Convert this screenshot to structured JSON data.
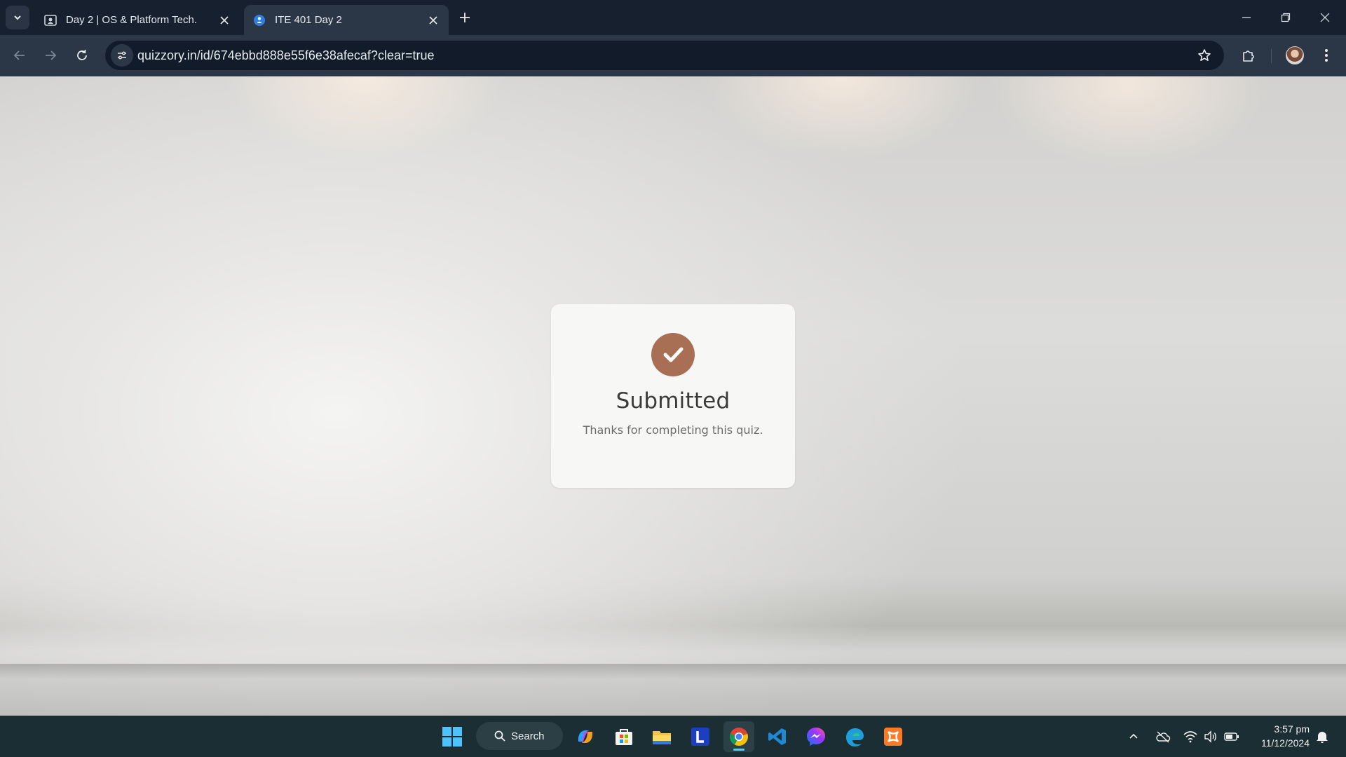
{
  "browser": {
    "tabs": [
      {
        "title": "Day 2 | OS & Platform Tech.",
        "active": false,
        "favicon": "classroom-icon"
      },
      {
        "title": "ITE 401 Day 2",
        "active": true,
        "favicon": "quizzory-icon"
      }
    ],
    "url": "quizzory.in/id/674ebbd888e55f6e38afecaf?clear=true"
  },
  "card": {
    "heading": "Submitted",
    "message": "Thanks for completing this quiz.",
    "accent_color": "#a86f54"
  },
  "taskbar": {
    "search_label": "Search",
    "apps": [
      "windows-start-icon",
      "copilot-icon",
      "microsoft-store-icon",
      "file-explorer-icon",
      "l-app-icon",
      "chrome-icon",
      "vscode-icon",
      "messenger-icon",
      "edge-icon",
      "xampp-icon"
    ],
    "time": "3:57 pm",
    "date": "11/12/2024"
  }
}
